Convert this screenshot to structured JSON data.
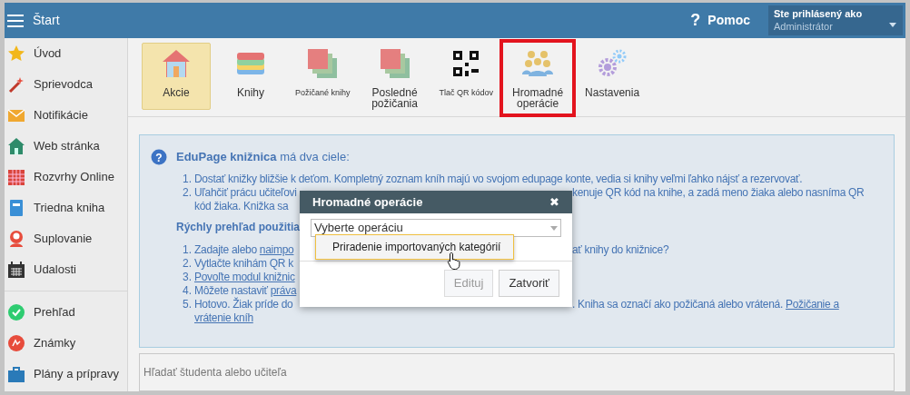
{
  "header": {
    "title": "Štart",
    "help_icon": "?",
    "help": "Pomoc",
    "user_label": "Ste prihlásený ako",
    "user_name": "Administrátor"
  },
  "sidebar": {
    "groups": [
      [
        {
          "label": "Úvod",
          "kind": "star"
        },
        {
          "label": "Sprievodca",
          "kind": "wand"
        },
        {
          "label": "Notifikácie",
          "kind": "mail"
        },
        {
          "label": "Web stránka",
          "kind": "home"
        },
        {
          "label": "Rozvrhy Online",
          "kind": "grid"
        },
        {
          "label": "Triedna kniha",
          "kind": "book"
        },
        {
          "label": "Suplovanie",
          "kind": "person"
        },
        {
          "label": "Udalosti",
          "kind": "calendar"
        }
      ],
      [
        {
          "label": "Prehľad",
          "kind": "check"
        },
        {
          "label": "Známky",
          "kind": "grade"
        },
        {
          "label": "Plány a prípravy",
          "kind": "case"
        }
      ]
    ]
  },
  "toolbar": [
    {
      "label": "Akcie",
      "kind": "house",
      "selected": true,
      "highlighted": false,
      "compact": false
    },
    {
      "label": "Knihy",
      "kind": "books",
      "selected": false,
      "highlighted": false,
      "compact": false
    },
    {
      "label": "Požičané knihy",
      "kind": "squares",
      "selected": false,
      "highlighted": false,
      "compact": true
    },
    {
      "label": "Posledné požičania",
      "kind": "squares",
      "selected": false,
      "highlighted": false,
      "compact": false
    },
    {
      "label": "Tlač QR kódov",
      "kind": "qr",
      "selected": false,
      "highlighted": false,
      "compact": true
    },
    {
      "label": "Hromadné operácie",
      "kind": "group",
      "selected": false,
      "highlighted": true,
      "compact": false
    },
    {
      "label": "Nastavenia",
      "kind": "gears",
      "selected": false,
      "highlighted": false,
      "compact": false
    }
  ],
  "info": {
    "icon": "?",
    "title": "**EduPage knižnica** má dva ciele:",
    "goals": [
      {
        "number": "1.",
        "full": [
          {
            "text": "Dostať knižky bližšie k deťom. Kompletný zoznam kníh majú vo svojom edupage konte, vedia si knihy veľmi ľahko nájsť a rezervovať.",
            "link": false
          }
        ]
      },
      {
        "number": "2.",
        "left": [
          {
            "text": "Uľahčiť prácu učiteľovi",
            "link": false
          }
        ],
        "right": [
          {
            "text": "kenuje QR kód na knihe, a zadá meno žiaka alebo nasníma QR",
            "link": false
          }
        ]
      },
      {
        "left": [
          {
            "text": "kód žiaka. Knižka sa",
            "link": false
          }
        ]
      }
    ],
    "heading": "Rýchly prehľad použitia",
    "steps": [
      {
        "number": "1.",
        "left": [
          {
            "text": "Zadajte alebo ",
            "link": false
          },
          {
            "text": "naimpo",
            "link": true
          }
        ],
        "right": [
          {
            "text": "ať knihy do knižnice?",
            "link": false
          }
        ]
      },
      {
        "number": "2.",
        "left": [
          {
            "text": "Vytlačte knihám QR k",
            "link": false
          }
        ]
      },
      {
        "number": "3.",
        "left": [
          {
            "text": "Povoľte modul knižnic",
            "link": true
          }
        ]
      },
      {
        "number": "4.",
        "left": [
          {
            "text": "Môžete nastaviť ",
            "link": false
          },
          {
            "text": "práva",
            "link": true
          }
        ]
      },
      {
        "number": "5.",
        "left": [
          {
            "text": "Hotovo. Žiak príde do",
            "link": false
          }
        ],
        "right": [
          {
            "text": ". Kniha sa označí ako požičaná alebo vrátená. ",
            "link": false
          },
          {
            "text": "Požičanie a",
            "link": true
          }
        ]
      },
      {
        "left": [
          {
            "text": "vrátenie kníh",
            "link": true
          }
        ]
      }
    ]
  },
  "dialog": {
    "title": "Hromadné operácie",
    "close": "✖",
    "select_placeholder": "Vyberte operáciu",
    "options": [
      {
        "label": "Priradenie importovaných kategórií",
        "hovered": true
      }
    ],
    "buttons": [
      {
        "label": "Edituj",
        "disabled": true
      },
      {
        "label": "Zatvoriť",
        "disabled": false
      }
    ]
  },
  "search": {
    "placeholder": "Hľadať študenta alebo učiteľa"
  }
}
